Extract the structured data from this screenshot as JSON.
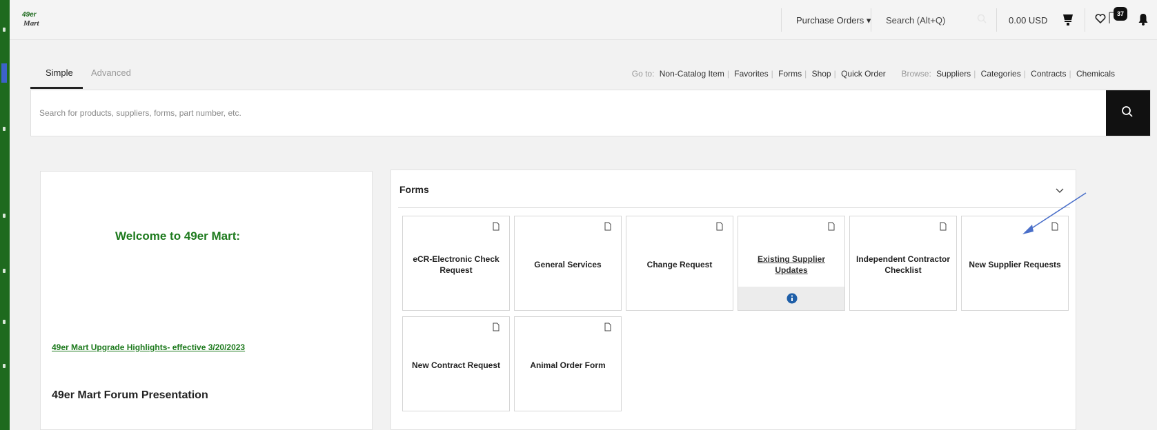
{
  "app": {
    "logo_text_top": "49er",
    "logo_text_bottom": "Mart"
  },
  "topbar": {
    "purchase_orders": "Purchase Orders ▾",
    "search_label": "Search (Alt+Q)",
    "cart_amount": "0.00 USD",
    "message_badge": "37"
  },
  "search": {
    "tabs": [
      {
        "label": "Simple",
        "active": true
      },
      {
        "label": "Advanced",
        "active": false
      }
    ],
    "goto_label": "Go to:",
    "goto_links": [
      "Non-Catalog Item",
      "Favorites",
      "Forms",
      "Shop",
      "Quick Order"
    ],
    "browse_label": "Browse:",
    "browse_links": [
      "Suppliers",
      "Categories",
      "Contracts",
      "Chemicals"
    ],
    "placeholder": "Search for products, suppliers, forms, part number, etc."
  },
  "welcome": {
    "title": "Welcome to 49er Mart:",
    "highlights_link": "49er Mart Upgrade Highlights- effective 3/20/2023",
    "forum_title": "49er Mart Forum Presentation"
  },
  "forms": {
    "title": "Forms",
    "tiles": [
      {
        "label": "eCR-Electronic Check Request",
        "link": false,
        "info": false
      },
      {
        "label": "General Services",
        "link": false,
        "info": false
      },
      {
        "label": "Change Request",
        "link": false,
        "info": false
      },
      {
        "label": "Existing Supplier Updates",
        "link": true,
        "info": true
      },
      {
        "label": "Independent Contractor Checklist",
        "link": false,
        "info": false
      },
      {
        "label": "New Supplier Requests",
        "link": false,
        "info": false
      },
      {
        "label": "New Contract Request",
        "link": false,
        "info": false
      },
      {
        "label": "Animal Order Form",
        "link": false,
        "info": false
      }
    ]
  },
  "colors": {
    "brand_green": "#1d7a1d",
    "sidebar_green": "#1e6a1e",
    "info_blue": "#1f5fa8",
    "annotation_arrow": "#4a6fc9"
  }
}
